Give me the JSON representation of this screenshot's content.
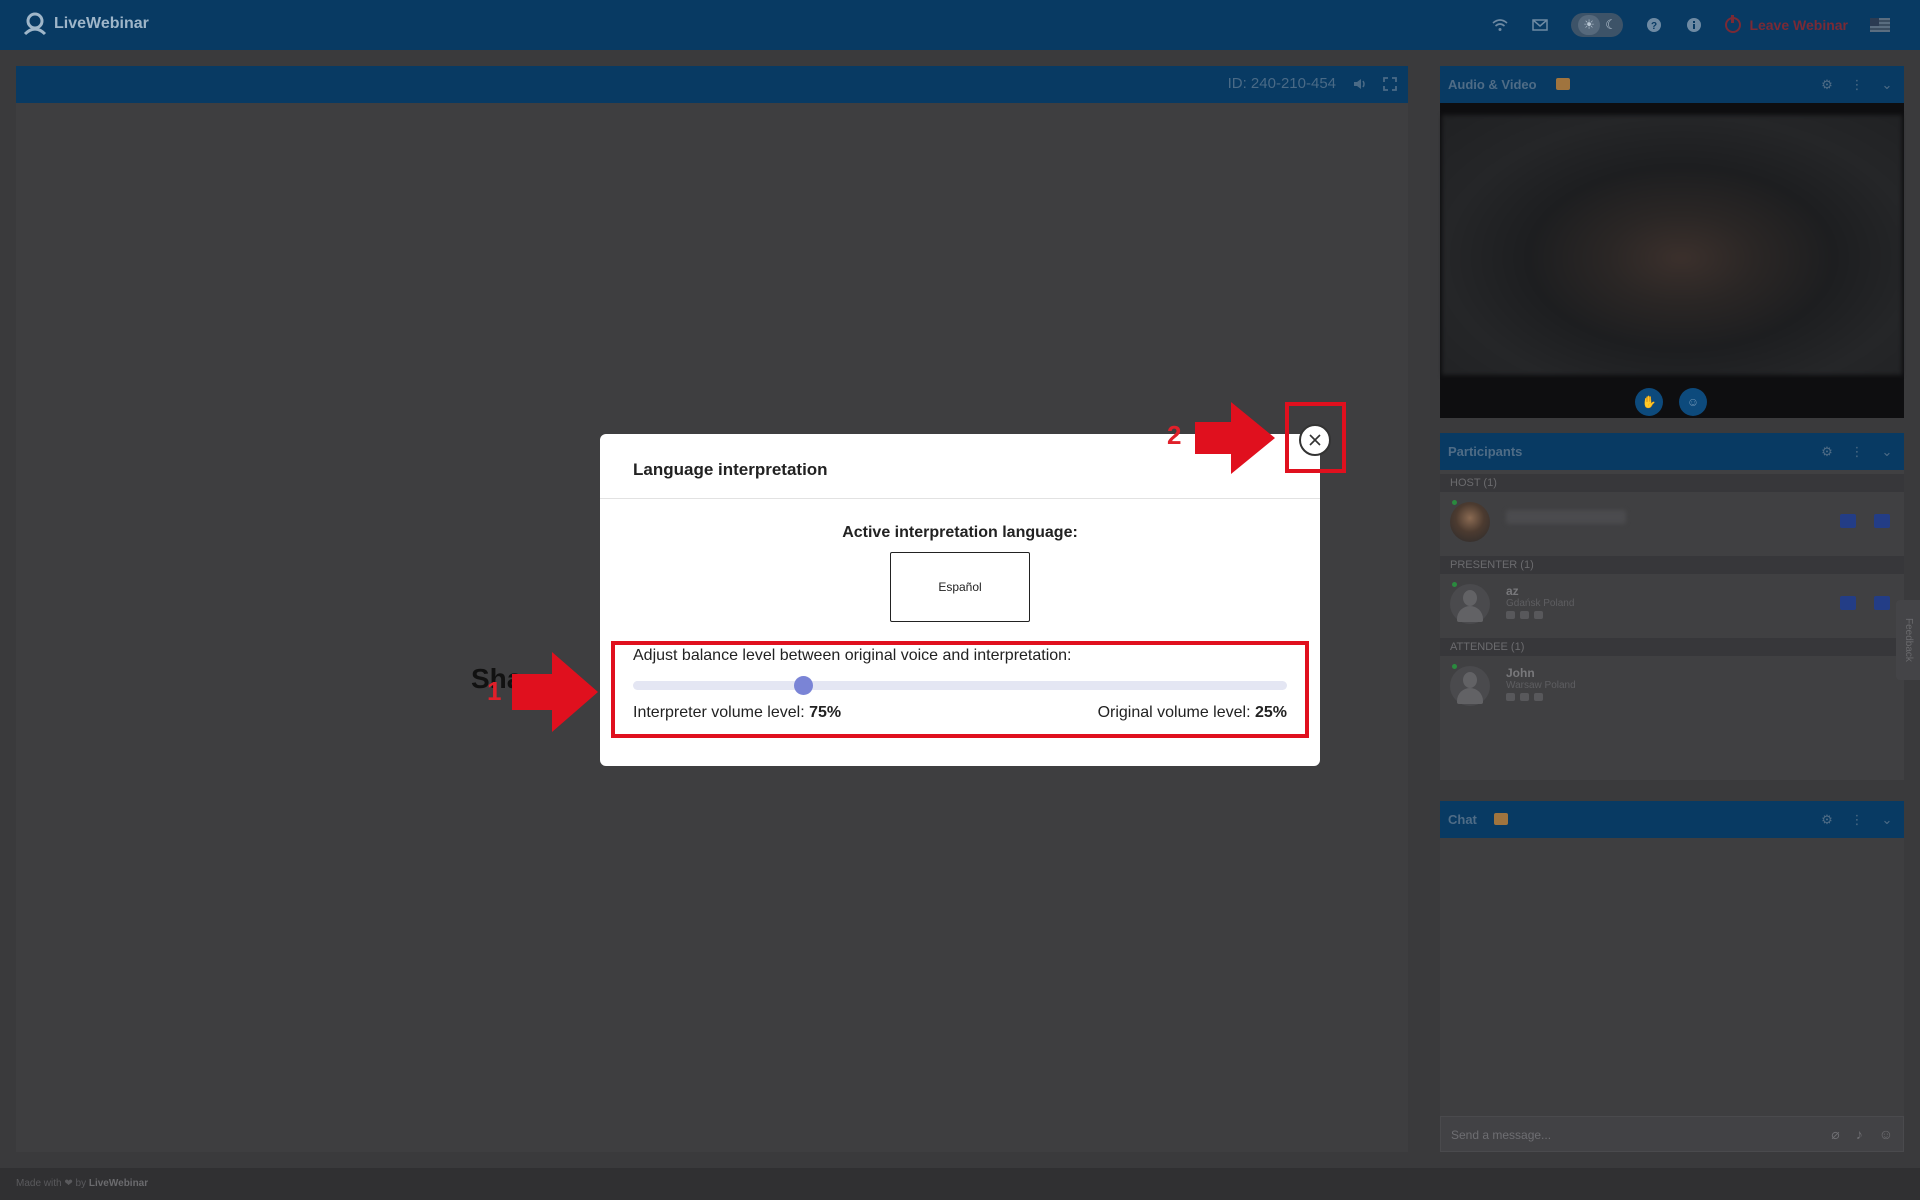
{
  "app": {
    "logo_text": "LiveWebinar",
    "leave_label": "Leave Webinar"
  },
  "top_icons": [
    "wifi-icon",
    "mail-icon",
    "sun-icon",
    "moon-icon",
    "help-icon",
    "info-icon",
    "power-icon",
    "flag-icon"
  ],
  "presentation": {
    "id_text": "ID: 240-210-454",
    "share_text": "Sha"
  },
  "panels": {
    "audio_video": {
      "title": "Audio & Video"
    },
    "participants": {
      "title": "Participants",
      "sections": {
        "host": "HOST (1)",
        "presenter": "PRESENTER (1)",
        "attendee": "ATTENDEE (1)"
      },
      "presenter": {
        "name": "az",
        "location": "Gdańsk Poland"
      },
      "attendee": {
        "name": "John",
        "location": "Warsaw Poland"
      }
    },
    "chat": {
      "title": "Chat",
      "placeholder": "Send a message..."
    }
  },
  "feedback_label": "Feedback",
  "footer": {
    "prefix": "Made with ❤ by",
    "brand": "LiveWebinar"
  },
  "modal": {
    "title": "Language interpretation",
    "active_label": "Active interpretation language:",
    "language": "Español",
    "balance_label": "Adjust balance level between original voice and interpretation:",
    "interpreter_label": "Interpreter volume level: ",
    "interpreter_value": "75%",
    "original_label": "Original volume level: ",
    "original_value": "25%",
    "balance_fraction": 0.26
  },
  "annotations": {
    "step1": "1",
    "step2": "2",
    "color": "#e0101e"
  }
}
